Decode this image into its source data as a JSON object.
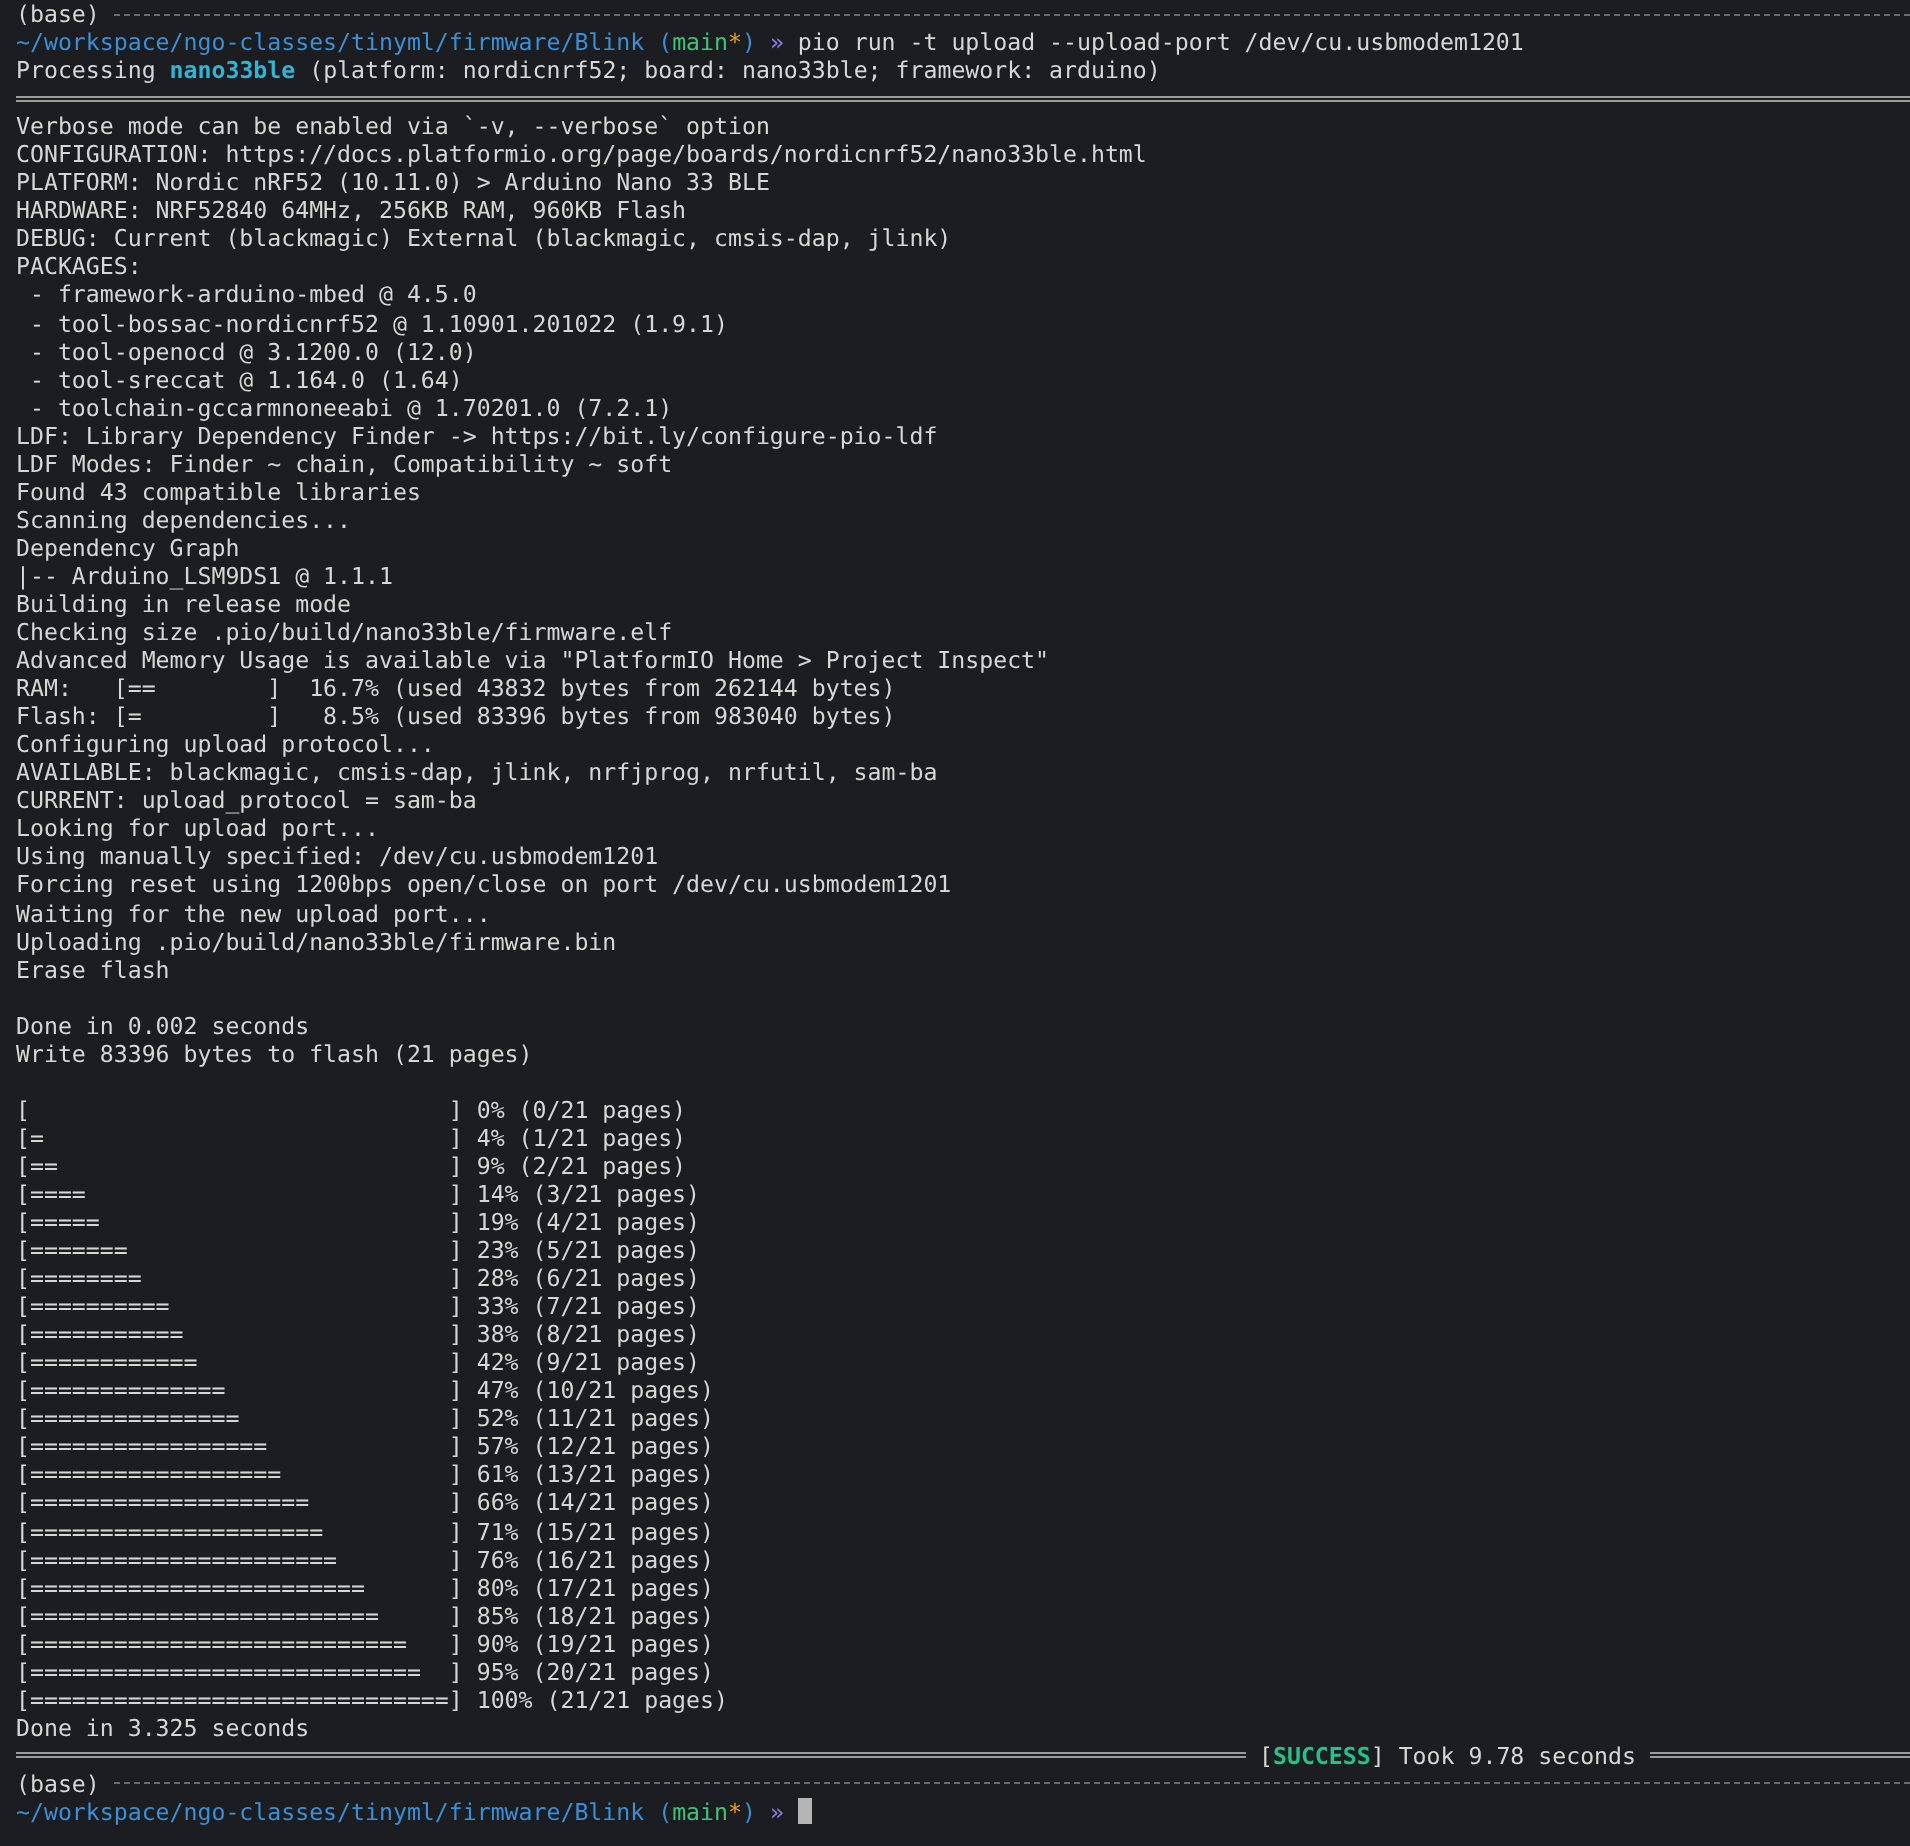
{
  "lines": [
    {
      "kind": "base",
      "text": "(base)"
    },
    {
      "kind": "prompt",
      "segments": [
        {
          "kind": "path",
          "text": "~/workspace/ngo-classes/tinyml/firmware/Blink"
        },
        {
          "kind": "paren",
          "text": "("
        },
        {
          "kind": "branch",
          "text": "main"
        },
        {
          "kind": "dirty",
          "text": "*"
        },
        {
          "kind": "paren",
          "text": ")"
        },
        {
          "kind": "arrow",
          "text": "»"
        },
        {
          "kind": "command",
          "text": "pio run -t upload --upload-port /dev/cu.usbmodem1201"
        }
      ]
    },
    {
      "kind": "processing",
      "segments": [
        {
          "kind": "plain",
          "text": "Processing"
        },
        {
          "kind": "target",
          "text": "nano33ble"
        },
        {
          "kind": "plain",
          "text": "(platform: nordicnrf52; board: nano33ble; framework: arduino)"
        }
      ]
    },
    {
      "kind": "rule"
    },
    {
      "kind": "text",
      "text": "Verbose mode can be enabled via `-v, --verbose` option"
    },
    {
      "kind": "text",
      "text": "CONFIGURATION: https://docs.platformio.org/page/boards/nordicnrf52/nano33ble.html"
    },
    {
      "kind": "text",
      "text": "PLATFORM: Nordic nRF52 (10.11.0) > Arduino Nano 33 BLE"
    },
    {
      "kind": "text",
      "text": "HARDWARE: NRF52840 64MHz, 256KB RAM, 960KB Flash"
    },
    {
      "kind": "text",
      "text": "DEBUG: Current (blackmagic) External (blackmagic, cmsis-dap, jlink)"
    },
    {
      "kind": "text",
      "text": "PACKAGES:"
    },
    {
      "kind": "text",
      "text": " - framework-arduino-mbed @ 4.5.0"
    },
    {
      "kind": "text",
      "text": " - tool-bossac-nordicnrf52 @ 1.10901.201022 (1.9.1)"
    },
    {
      "kind": "text",
      "text": " - tool-openocd @ 3.1200.0 (12.0)"
    },
    {
      "kind": "text",
      "text": " - tool-sreccat @ 1.164.0 (1.64)"
    },
    {
      "kind": "text",
      "text": " - toolchain-gccarmnoneeabi @ 1.70201.0 (7.2.1)"
    },
    {
      "kind": "text",
      "text": "LDF: Library Dependency Finder -> https://bit.ly/configure-pio-ldf"
    },
    {
      "kind": "text",
      "text": "LDF Modes: Finder ~ chain, Compatibility ~ soft"
    },
    {
      "kind": "text",
      "text": "Found 43 compatible libraries"
    },
    {
      "kind": "text",
      "text": "Scanning dependencies..."
    },
    {
      "kind": "text",
      "text": "Dependency Graph"
    },
    {
      "kind": "text",
      "text": "|-- Arduino_LSM9DS1 @ 1.1.1"
    },
    {
      "kind": "text",
      "text": "Building in release mode"
    },
    {
      "kind": "text",
      "text": "Checking size .pio/build/nano33ble/firmware.elf"
    },
    {
      "kind": "text",
      "text": "Advanced Memory Usage is available via \"PlatformIO Home > Project Inspect\""
    },
    {
      "kind": "text",
      "text": "RAM:   [==        ]  16.7% (used 43832 bytes from 262144 bytes)"
    },
    {
      "kind": "text",
      "text": "Flash: [=         ]   8.5% (used 83396 bytes from 983040 bytes)"
    },
    {
      "kind": "text",
      "text": "Configuring upload protocol..."
    },
    {
      "kind": "text",
      "text": "AVAILABLE: blackmagic, cmsis-dap, jlink, nrfjprog, nrfutil, sam-ba"
    },
    {
      "kind": "text",
      "text": "CURRENT: upload_protocol = sam-ba"
    },
    {
      "kind": "text",
      "text": "Looking for upload port..."
    },
    {
      "kind": "text",
      "text": "Using manually specified: /dev/cu.usbmodem1201"
    },
    {
      "kind": "text",
      "text": "Forcing reset using 1200bps open/close on port /dev/cu.usbmodem1201"
    },
    {
      "kind": "text",
      "text": "Waiting for the new upload port..."
    },
    {
      "kind": "text",
      "text": "Uploading .pio/build/nano33ble/firmware.bin"
    },
    {
      "kind": "text",
      "text": "Erase flash"
    },
    {
      "kind": "blank"
    },
    {
      "kind": "text",
      "text": "Done in 0.002 seconds"
    },
    {
      "kind": "text",
      "text": "Write 83396 bytes to flash (21 pages)"
    },
    {
      "kind": "blank"
    },
    {
      "kind": "text",
      "text": "[                              ] 0% (0/21 pages)"
    },
    {
      "kind": "text",
      "text": "[=                             ] 4% (1/21 pages)"
    },
    {
      "kind": "text",
      "text": "[==                            ] 9% (2/21 pages)"
    },
    {
      "kind": "text",
      "text": "[====                          ] 14% (3/21 pages)"
    },
    {
      "kind": "text",
      "text": "[=====                         ] 19% (4/21 pages)"
    },
    {
      "kind": "text",
      "text": "[=======                       ] 23% (5/21 pages)"
    },
    {
      "kind": "text",
      "text": "[========                      ] 28% (6/21 pages)"
    },
    {
      "kind": "text",
      "text": "[==========                    ] 33% (7/21 pages)"
    },
    {
      "kind": "text",
      "text": "[===========                   ] 38% (8/21 pages)"
    },
    {
      "kind": "text",
      "text": "[============                  ] 42% (9/21 pages)"
    },
    {
      "kind": "text",
      "text": "[==============                ] 47% (10/21 pages)"
    },
    {
      "kind": "text",
      "text": "[===============               ] 52% (11/21 pages)"
    },
    {
      "kind": "text",
      "text": "[=================             ] 57% (12/21 pages)"
    },
    {
      "kind": "text",
      "text": "[==================            ] 61% (13/21 pages)"
    },
    {
      "kind": "text",
      "text": "[====================          ] 66% (14/21 pages)"
    },
    {
      "kind": "text",
      "text": "[=====================         ] 71% (15/21 pages)"
    },
    {
      "kind": "text",
      "text": "[======================        ] 76% (16/21 pages)"
    },
    {
      "kind": "text",
      "text": "[========================      ] 80% (17/21 pages)"
    },
    {
      "kind": "text",
      "text": "[=========================     ] 85% (18/21 pages)"
    },
    {
      "kind": "text",
      "text": "[===========================   ] 90% (19/21 pages)"
    },
    {
      "kind": "text",
      "text": "[============================  ] 95% (20/21 pages)"
    },
    {
      "kind": "text",
      "text": "[==============================] 100% (21/21 pages)"
    },
    {
      "kind": "text",
      "text": "Done in 3.325 seconds"
    },
    {
      "kind": "result",
      "segments": [
        {
          "kind": "bracket",
          "text": "["
        },
        {
          "kind": "success",
          "text": "SUCCESS"
        },
        {
          "kind": "bracket",
          "text": "]"
        },
        {
          "kind": "plain",
          "text": "Took 9.78 seconds"
        }
      ]
    },
    {
      "kind": "base",
      "text": "(base)"
    },
    {
      "kind": "prompt",
      "segments": [
        {
          "kind": "path",
          "text": "~/workspace/ngo-classes/tinyml/firmware/Blink"
        },
        {
          "kind": "paren",
          "text": "("
        },
        {
          "kind": "branch",
          "text": "main"
        },
        {
          "kind": "dirty",
          "text": "*"
        },
        {
          "kind": "paren",
          "text": ")"
        },
        {
          "kind": "arrow",
          "text": "»"
        }
      ],
      "cursor": true
    }
  ]
}
